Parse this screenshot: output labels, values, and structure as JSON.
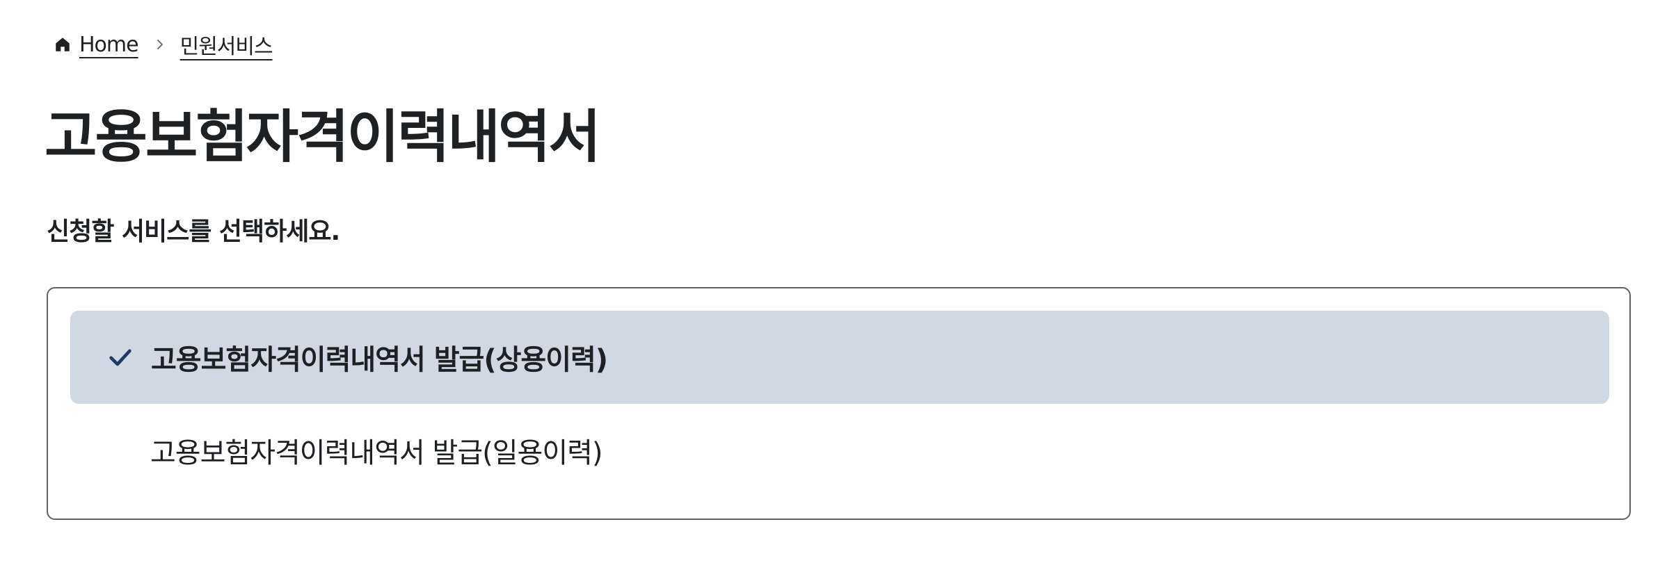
{
  "breadcrumb": {
    "home_icon": "home-icon",
    "separator_icon": "chevron-right-icon",
    "items": [
      {
        "label": "Home"
      },
      {
        "label": "민원서비스"
      }
    ]
  },
  "page": {
    "title": "고용보험자격이력내역서",
    "instruction": "신청할 서비스를 선택하세요."
  },
  "options": [
    {
      "label": "고용보험자격이력내역서 발급(상용이력)",
      "selected": true,
      "icon": "check-icon"
    },
    {
      "label": "고용보험자격이력내역서 발급(일용이력)",
      "selected": false
    }
  ],
  "colors": {
    "text": "#1e2124",
    "selected_bg": "#d0d8e3",
    "check": "#1f3a68",
    "panel_border": "#5f6368"
  }
}
